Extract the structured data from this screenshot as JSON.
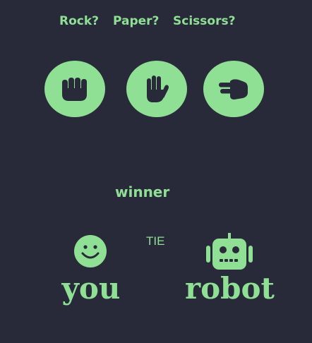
{
  "prompts": {
    "rock": "Rock?",
    "paper": "Paper?",
    "scissors": "Scissors?"
  },
  "choices": [
    {
      "id": "rock",
      "icon": "fist-icon"
    },
    {
      "id": "paper",
      "icon": "open-hand-icon"
    },
    {
      "id": "scissors",
      "icon": "scissors-hand-icon"
    }
  ],
  "winner_heading": "winner",
  "result": "TIE",
  "player": {
    "label": "you",
    "icon": "smiley-face-icon"
  },
  "opponent": {
    "label": "robot",
    "icon": "robot-icon"
  },
  "colors": {
    "background": "#282a3a",
    "accent": "#8fdf94"
  }
}
